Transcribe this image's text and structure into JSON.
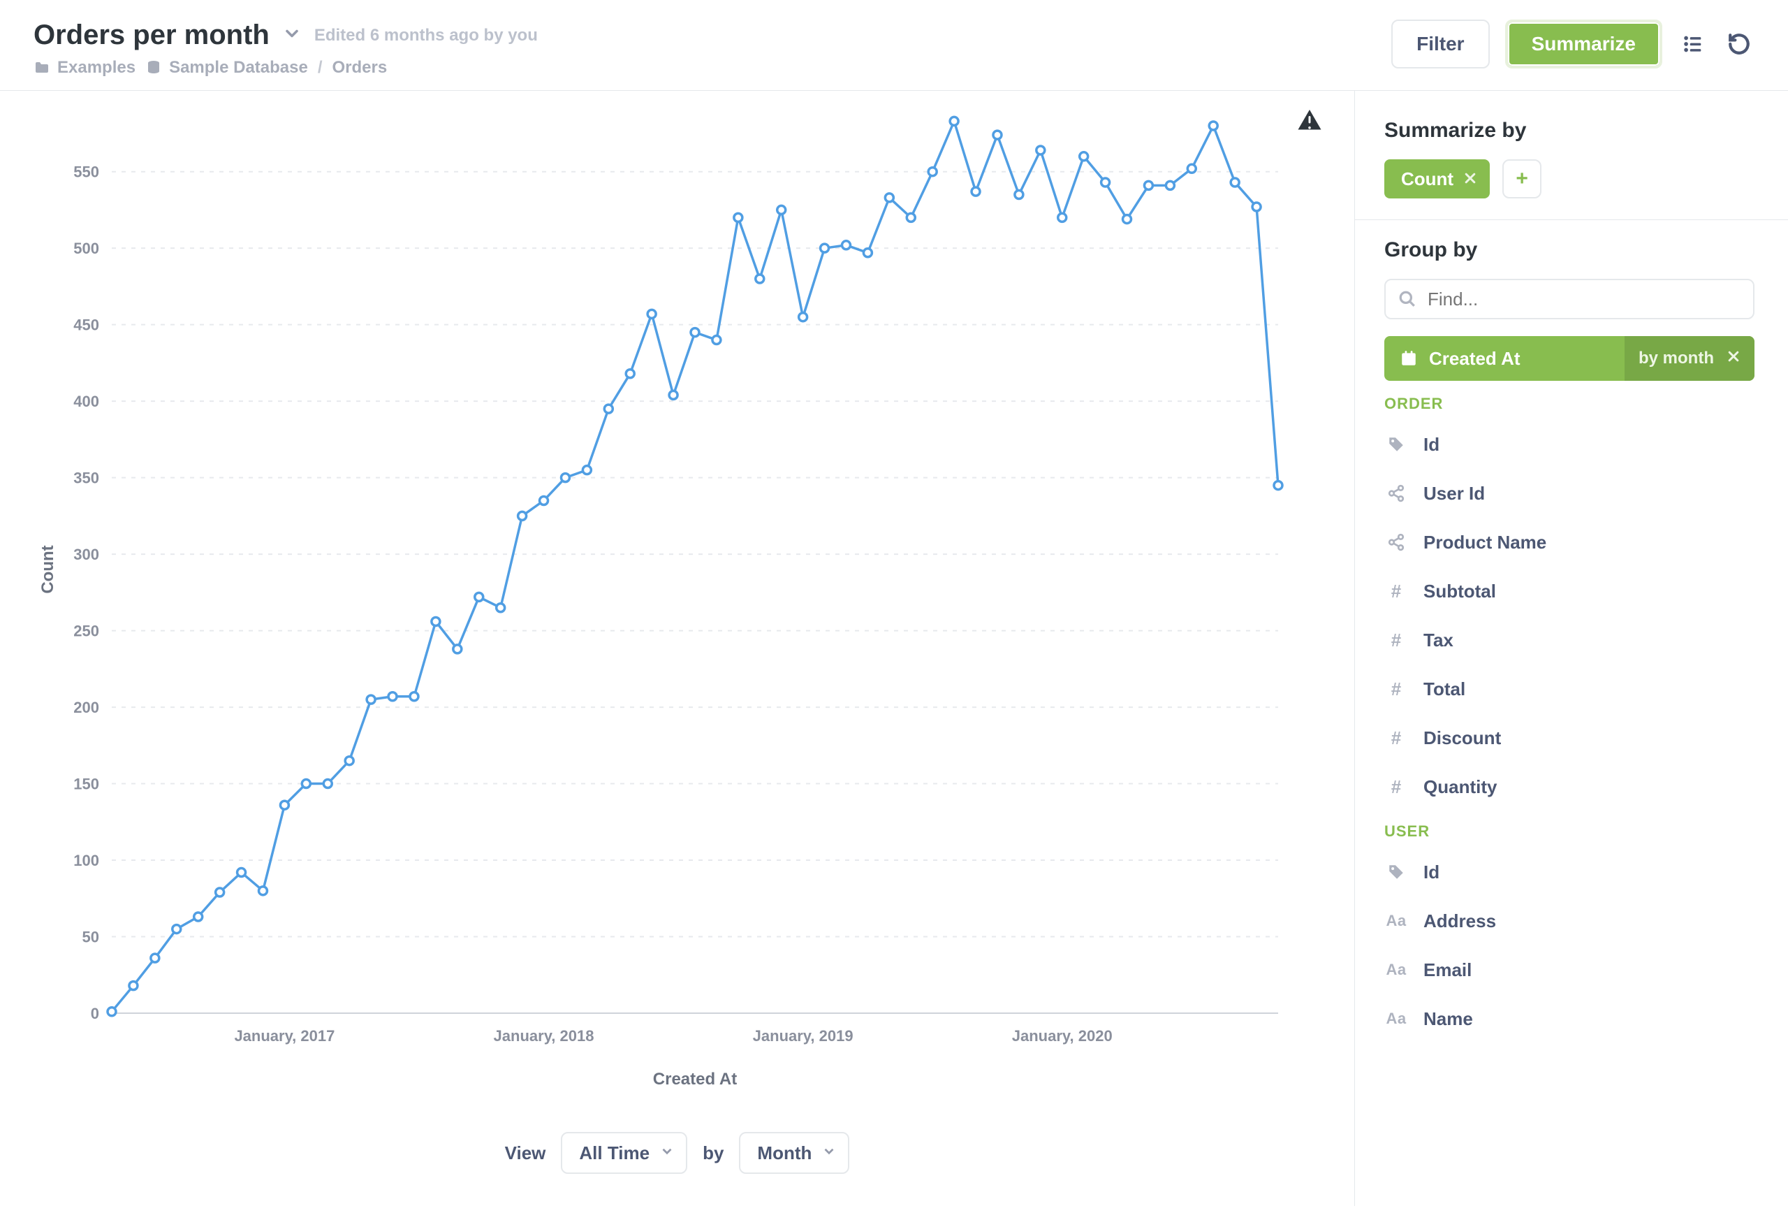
{
  "header": {
    "title": "Orders per month",
    "edited": "Edited 6 months ago by you",
    "breadcrumbs": {
      "collection": "Examples",
      "database": "Sample Database",
      "table": "Orders"
    },
    "filter_label": "Filter",
    "summarize_label": "Summarize"
  },
  "view_controls": {
    "view_label": "View",
    "range_value": "All Time",
    "by_label": "by",
    "granularity_value": "Month"
  },
  "sidebar": {
    "summarize_heading": "Summarize by",
    "agg_chip": "Count",
    "groupby_heading": "Group by",
    "search_placeholder": "Find...",
    "group_pill": {
      "field": "Created At",
      "binning": "by month"
    },
    "section_order": "ORDER",
    "order_fields": [
      "Id",
      "User Id",
      "Product Name",
      "Subtotal",
      "Tax",
      "Total",
      "Discount",
      "Quantity"
    ],
    "order_field_icons": [
      "tag",
      "share",
      "share",
      "hash",
      "hash",
      "hash",
      "hash",
      "hash"
    ],
    "section_user": "USER",
    "user_fields": [
      "Id",
      "Address",
      "Email",
      "Name"
    ],
    "user_field_icons": [
      "tag",
      "aa",
      "aa",
      "aa"
    ]
  },
  "chart_data": {
    "type": "line",
    "title": "",
    "xlabel": "Created At",
    "ylabel": "Count",
    "ylim": [
      0,
      580
    ],
    "yticks": [
      0,
      50,
      100,
      150,
      200,
      250,
      300,
      350,
      400,
      450,
      500,
      550
    ],
    "x_tick_labels": [
      "January, 2017",
      "January, 2018",
      "January, 2019",
      "January, 2020"
    ],
    "x_tick_indices": [
      8,
      20,
      32,
      44
    ],
    "categories": [
      "2016-05",
      "2016-06",
      "2016-07",
      "2016-08",
      "2016-09",
      "2016-10",
      "2016-11",
      "2016-12",
      "2017-01",
      "2017-02",
      "2017-03",
      "2017-04",
      "2017-05",
      "2017-06",
      "2017-07",
      "2017-08",
      "2017-09",
      "2017-10",
      "2017-11",
      "2017-12",
      "2018-01",
      "2018-02",
      "2018-03",
      "2018-04",
      "2018-05",
      "2018-06",
      "2018-07",
      "2018-08",
      "2018-09",
      "2018-10",
      "2018-11",
      "2018-12",
      "2019-01",
      "2019-02",
      "2019-03",
      "2019-04",
      "2019-05",
      "2019-06",
      "2019-07",
      "2019-08",
      "2019-09",
      "2019-10",
      "2019-11",
      "2019-12",
      "2020-01",
      "2020-02",
      "2020-03",
      "2020-04"
    ],
    "series": [
      {
        "name": "Count",
        "values": [
          1,
          18,
          36,
          55,
          63,
          79,
          92,
          80,
          136,
          150,
          150,
          165,
          205,
          207,
          207,
          256,
          238,
          272,
          265,
          325,
          335,
          350,
          355,
          395,
          418,
          457,
          404,
          445,
          440,
          520,
          480,
          525,
          455,
          500,
          502,
          497,
          533,
          520,
          550,
          583,
          537,
          574,
          535,
          564,
          520,
          560,
          543,
          519
        ]
      }
    ],
    "extra_series_tail": [
      {
        "idx": 44,
        "v": 520
      },
      {
        "idx": 45,
        "v": 560
      },
      {
        "idx": 46,
        "v": 543
      },
      {
        "idx": 47,
        "v": 519
      },
      {
        "idx": 48,
        "v": 541
      },
      {
        "idx": 49,
        "v": 541
      },
      {
        "idx": 50,
        "v": 552
      },
      {
        "idx": 51,
        "v": 580
      },
      {
        "idx": 52,
        "v": 543
      },
      {
        "idx": 53,
        "v": 527
      },
      {
        "idx": 54,
        "v": 345
      }
    ]
  }
}
